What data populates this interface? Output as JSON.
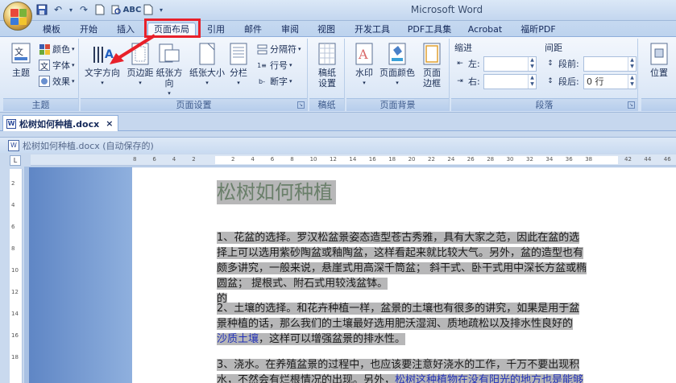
{
  "app": {
    "title": "Microsoft Word"
  },
  "ribbon_tabs": [
    "模板",
    "开始",
    "插入",
    "页面布局",
    "引用",
    "邮件",
    "审阅",
    "视图",
    "开发工具",
    "PDF工具集",
    "Acrobat",
    "福昕PDF"
  ],
  "groups": {
    "theme": {
      "label": "主题",
      "big": "主题",
      "colors": "颜色",
      "fonts": "字体",
      "effects": "效果"
    },
    "page_setup": {
      "label": "页面设置",
      "text_direction": "文字方向",
      "margins": "页边距",
      "orientation": "纸张方向",
      "size": "纸张大小",
      "columns": "分栏",
      "breaks": "分隔符",
      "line_numbers": "行号",
      "hyphenation": "断字"
    },
    "manuscript": {
      "label": "稿纸",
      "btn_line1": "稿纸",
      "btn_line2": "设置"
    },
    "page_background": {
      "label": "页面背景",
      "watermark": "水印",
      "page_color": "页面颜色",
      "borders_line1": "页面",
      "borders_line2": "边框"
    },
    "paragraph": {
      "label": "段落",
      "indent_title": "缩进",
      "spacing_title": "间距",
      "left": "左:",
      "right": "右:",
      "before": "段前:",
      "after": "段后:",
      "after_value": "0 行"
    },
    "arrange": {
      "position": "位置"
    }
  },
  "doc_tab": {
    "name": "松树如何种植.docx",
    "close": "×"
  },
  "doc_window": {
    "title": "松树如何种植.docx (自动保存的)"
  },
  "ruler": {
    "corner": "L",
    "ticks": [
      "8",
      "6",
      "4",
      "2",
      "",
      "2",
      "4",
      "6",
      "8",
      "10",
      "12",
      "14",
      "16",
      "18",
      "20",
      "22",
      "24",
      "26",
      "28",
      "30",
      "32",
      "34",
      "36",
      "38",
      "",
      "42",
      "44",
      "46"
    ],
    "vticks": [
      "2",
      "4",
      "6",
      "8",
      "10",
      "12",
      "14",
      "16",
      "18"
    ]
  },
  "document": {
    "title": "松树如何种植",
    "para1_lines": [
      "1、花盆的选择。罗汉松盆景姿态造型苍古秀雅，具有大家之范，因此在盆的选",
      "择上可以选用紫砂陶盆或釉陶盆，这样看起来就比较大气。另外，盆的造型也有",
      "颇多讲究，一般来说，悬崖式用高深千筒盆；   斜干式、卧干式用中深长方盆或椭",
      "圆盆；   提根式、附石式用较浅盆钵。",
      "的"
    ],
    "para2_lines": [
      "2、土壤的选择。和花卉种植一样，盆景的土壤也有很多的讲究，如果是用于盆",
      "景种植的话，那么我们的土壤最好选用肥沃湿润、质地疏松以及排水性良好的"
    ],
    "para2_link": "沙质土壤",
    "para2_tail": "，这样可以增强盆景的排水性。",
    "para3_line1": "3、浇水。在养殖盆景的过程中，也应该要注意好浇水的工作，千万不要出现积",
    "para3_line2_start": "水，不然会有烂根情况的出现。另外，",
    "para3_link": "松树这种植物在没有阳光的地方也是能够"
  }
}
